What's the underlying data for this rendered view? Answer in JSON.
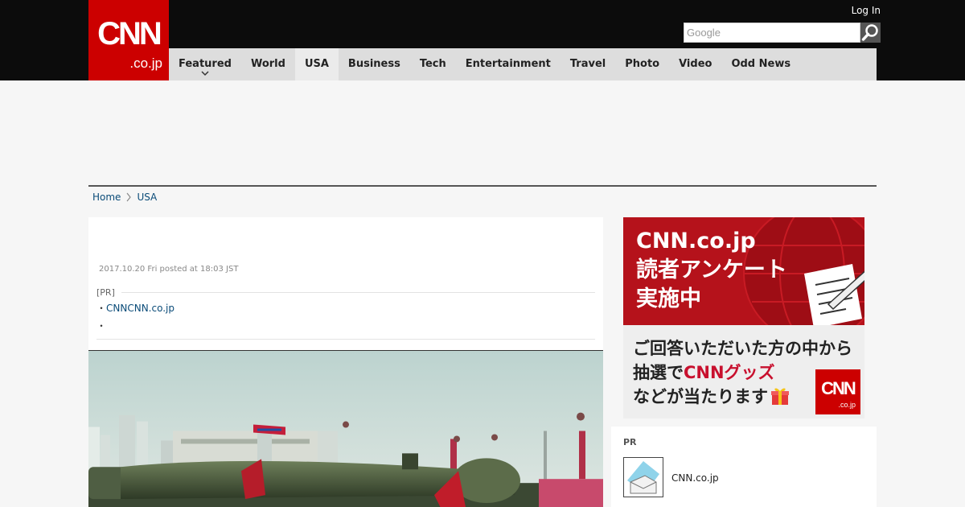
{
  "header": {
    "logo": {
      "mark": "CNN",
      "sub": ".co.jp"
    },
    "login": "Log In",
    "search": {
      "placeholder": "Google"
    }
  },
  "nav": {
    "items": [
      "Featured",
      "World",
      "USA",
      "Business",
      "Tech",
      "Entertainment",
      "Travel",
      "Photo",
      "Video",
      "Odd News"
    ],
    "active": "USA"
  },
  "breadcrumb": {
    "home": "Home",
    "section": "USA"
  },
  "article": {
    "posted": "2017.10.20 Fri posted at 18:03 JST",
    "pr_label": "[PR]",
    "pr_items": [
      "CNNCNN.co.jp",
      ""
    ]
  },
  "banner": {
    "title_line1": "CNN.co.jp",
    "title_line2": "読者アンケート",
    "title_line3": "実施中",
    "body_line1": "ご回答いただいた方の中から",
    "body_line2_pre": "抽選で",
    "body_line2_hl": "CNNグッズ",
    "body_line3": "などが当たります",
    "logo_mark": "CNN",
    "logo_sub": ".co.jp"
  },
  "sidebar_pr": {
    "label": "PR",
    "name": "CNN.co.jp"
  },
  "colors": {
    "brand_red": "#cc0000",
    "link": "#0a4b78",
    "header_bg": "#0c0c0c"
  }
}
